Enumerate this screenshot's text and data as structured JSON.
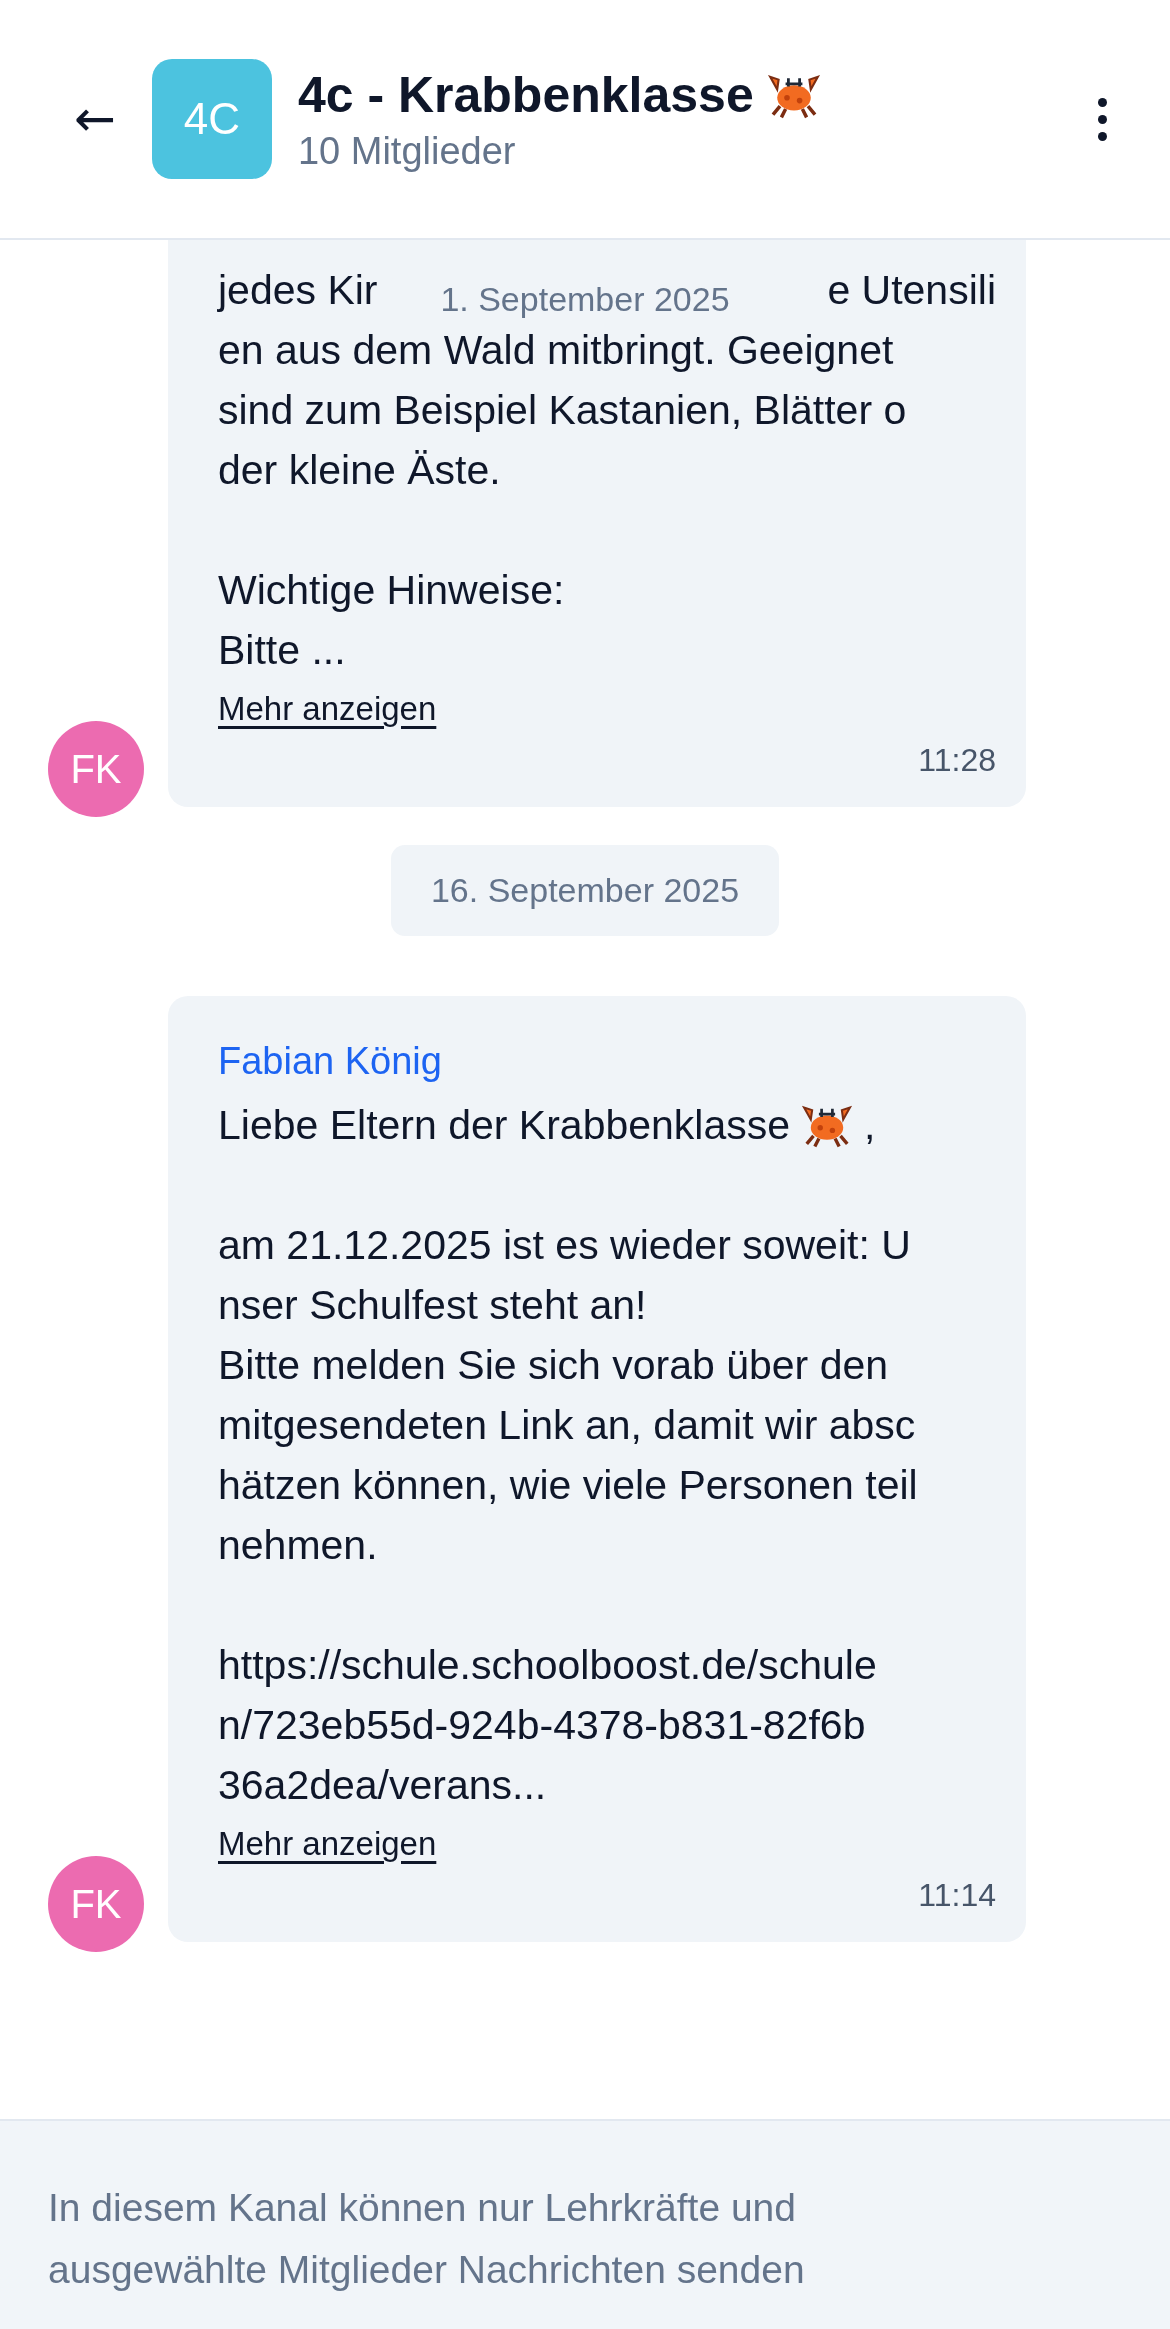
{
  "header": {
    "back": "←",
    "avatar": "4C",
    "title": "4c - Krabbenklasse",
    "subtitle": "10 Mitglieder"
  },
  "floating_date": "1. September 2025",
  "messages": [
    {
      "avatar": "FK",
      "lines": [
        {
          "kind": "split",
          "left": "jedes Kir",
          "right": "e Utensili"
        },
        "en aus dem Wald mitbringt. Geeignet",
        "sind zum Beispiel Kastanien, Blätter o",
        "der kleine Äste.",
        {
          "kind": "blank"
        },
        "Wichtige Hinweise:",
        "Bitte ..."
      ],
      "more": "Mehr anzeigen",
      "time": "11:28"
    },
    {
      "date": "16. September 2025"
    },
    {
      "sender": "Fabian König",
      "avatar": "FK",
      "lines": [
        {
          "kind": "icon",
          "before": "Liebe Eltern der Krabbenklasse",
          "after": ","
        },
        {
          "kind": "blank"
        },
        "am 21.12.2025 ist es wieder soweit: U",
        "nser Schulfest steht an!",
        "Bitte melden Sie sich vorab über den",
        "mitgesendeten Link an, damit wir absc",
        "hätzen können, wie viele Personen teil",
        "nehmen.",
        {
          "kind": "blank"
        },
        "https://schule.schoolboost.de/schule",
        "n/723eb55d-924b-4378-b831-82f6b",
        "36a2dea/verans..."
      ],
      "more": "Mehr anzeigen",
      "time": "11:14"
    }
  ],
  "footer": "In diesem Kanal können nur Lehrkräfte und ausgewählte Mitglieder Nachrichten senden"
}
